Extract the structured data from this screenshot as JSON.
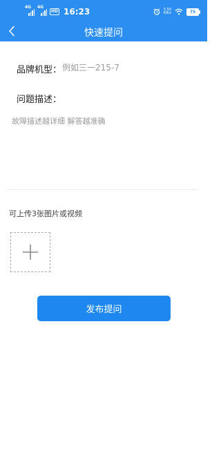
{
  "status_bar": {
    "sim1_tag": "4G",
    "sim2_tag": "4G",
    "hd_label": "HD",
    "time": "16:23",
    "net_speed_value": "5.50",
    "net_speed_unit": "KB/s",
    "battery_level": "75"
  },
  "nav": {
    "title": "快速提问",
    "back_icon": "chevron-left-icon"
  },
  "form": {
    "brand_label": "品牌机型：",
    "brand_placeholder": "例如三一215-7",
    "brand_value": "",
    "description_label": "问题描述：",
    "description_placeholder": "故障描述越详细 解答越准确",
    "description_value": "",
    "upload_hint": "可上传3张图片或视频",
    "upload_icon": "plus-icon",
    "submit_label": "发布提问"
  },
  "colors": {
    "primary": "#2b8ef0",
    "button": "#1e88f0",
    "placeholder": "#9a9a9a"
  }
}
